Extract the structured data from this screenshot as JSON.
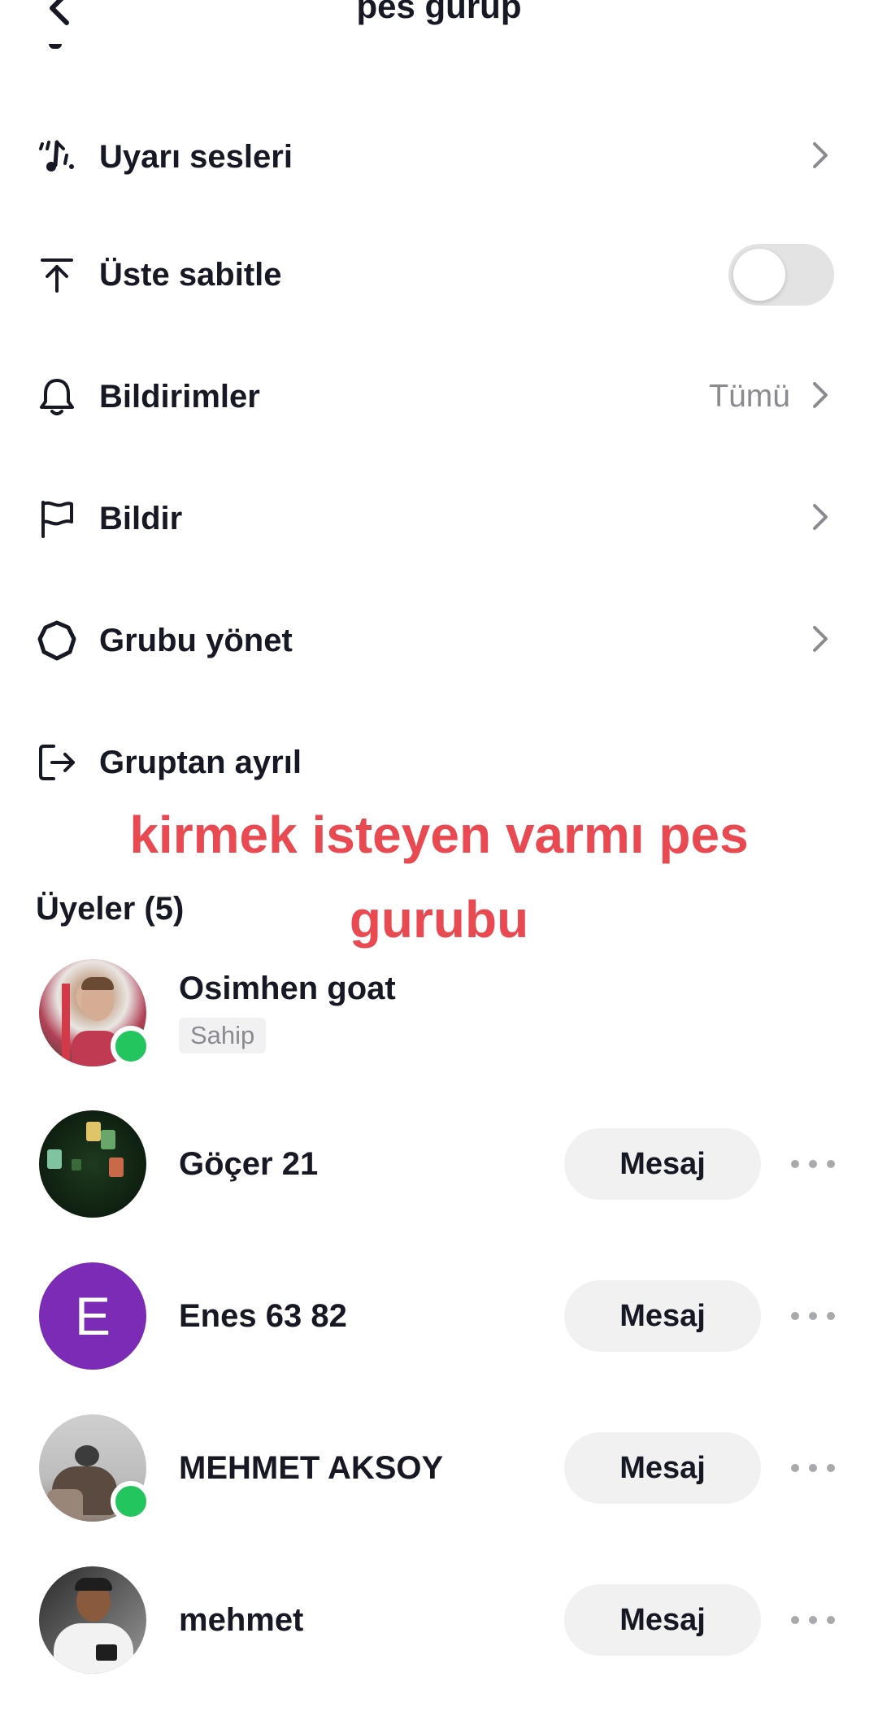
{
  "header": {
    "title": "pes gurup"
  },
  "settings": {
    "alert_sounds": {
      "label": "Uyarı sesleri"
    },
    "pin_top": {
      "label": "Üste sabitle",
      "enabled": false
    },
    "notifications": {
      "label": "Bildirimler",
      "value": "Tümü"
    },
    "report": {
      "label": "Bildir"
    },
    "manage_group": {
      "label": "Grubu yönet"
    },
    "leave_group": {
      "label": "Gruptan ayrıl"
    }
  },
  "overlay_caption": {
    "line1": "kirmek isteyen varmı pes",
    "line2": "gurubu"
  },
  "members": {
    "title": "Üyeler (5)",
    "message_label": "Mesaj",
    "items": [
      {
        "name": "Osimhen goat",
        "role": "Sahip",
        "online": true
      },
      {
        "name": "Göçer 21",
        "online": false
      },
      {
        "name": "Enes 63 82",
        "avatar_letter": "E",
        "avatar_color": "#7b2bb5",
        "online": false
      },
      {
        "name": "MEHMET AKSOY",
        "online": true
      },
      {
        "name": "mehmet",
        "online": false
      }
    ]
  },
  "colors": {
    "accent_red": "#e94a51",
    "online_green": "#23c55e",
    "toggle_off": "#e3e3e4"
  }
}
